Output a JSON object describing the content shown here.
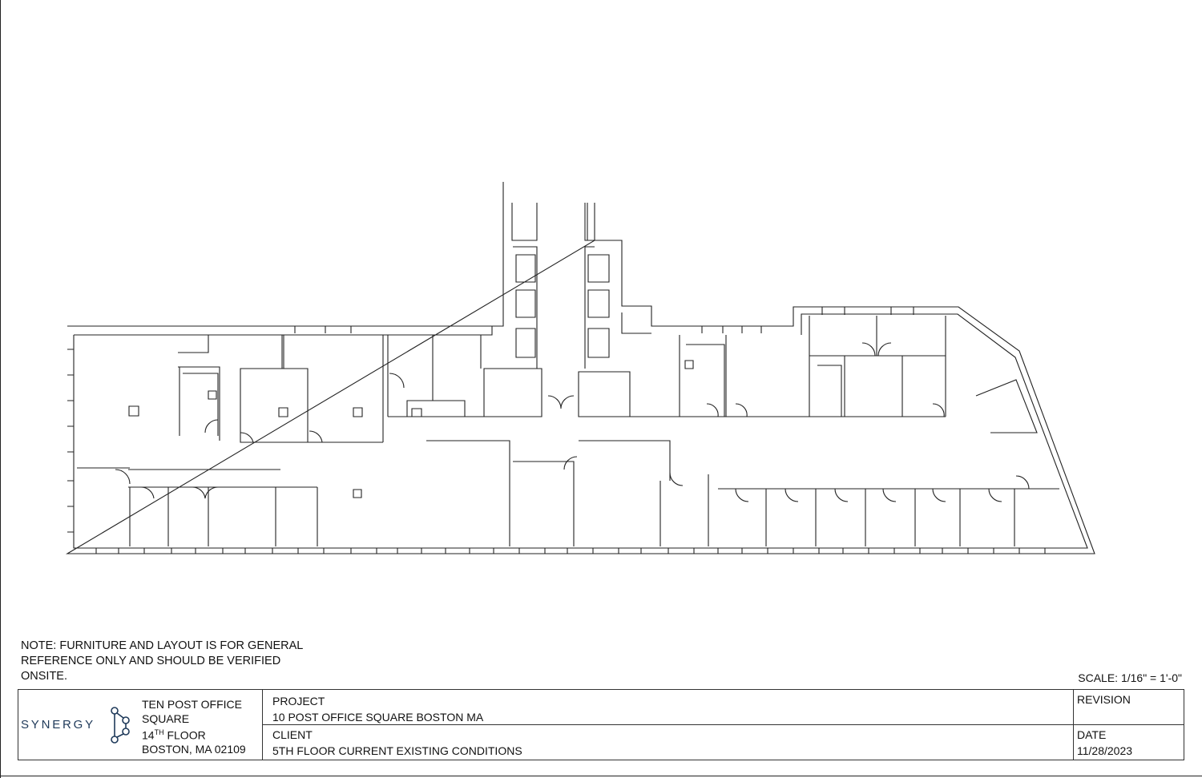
{
  "note": {
    "line1": "NOTE: FURNITURE AND LAYOUT IS FOR GENERAL",
    "line2": "REFERENCE ONLY AND SHOULD BE VERIFIED",
    "line3": "ONSITE."
  },
  "scale": "SCALE: 1/16\" = 1'-0\"",
  "title_block": {
    "logo": "SYNERGY",
    "address": {
      "line1": "TEN POST OFFICE",
      "line2": "SQUARE",
      "floor_number": "14",
      "floor_suffix": "TH",
      "floor_word": " FLOOR",
      "line4": "BOSTON, MA 02109"
    },
    "project_label": "PROJECT",
    "project_value": "10 POST OFFICE SQUARE BOSTON MA",
    "client_label": "CLIENT",
    "client_value": "5TH FLOOR CURRENT EXISTING CONDITIONS",
    "revision_label": "REVISION",
    "date_label": "DATE",
    "date_value": "11/28/2023"
  },
  "colors": {
    "line": "#222222",
    "logo": "#1f3a5a"
  }
}
